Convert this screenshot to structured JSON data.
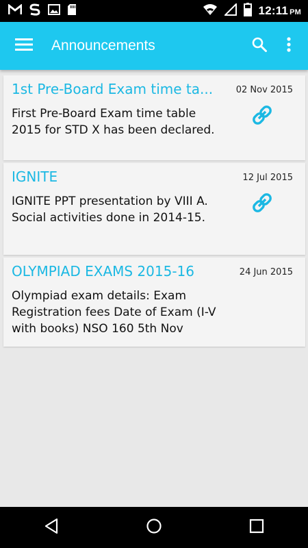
{
  "status_bar": {
    "time": "12:11",
    "ampm": "PM",
    "icons": [
      "gmail-icon",
      "sync-icon",
      "image-icon",
      "sd-card-icon",
      "wifi-icon",
      "signal-icon",
      "battery-icon"
    ]
  },
  "app_bar": {
    "title": "Announcements",
    "color": "#1ec8ef",
    "icons": [
      "menu-icon",
      "search-icon",
      "more-vert-icon"
    ]
  },
  "announcements": [
    {
      "title": "1st Pre-Board Exam time ta...",
      "description": "First Pre-Board Exam time table 2015 for STD X has been declared.",
      "date": "02 Nov 2015",
      "has_link": true
    },
    {
      "title": "IGNITE",
      "description": "IGNITE PPT presentation by VIII A. Social activities done in 2014-15.",
      "date": "12 Jul 2015",
      "has_link": true
    },
    {
      "title": "OLYMPIAD EXAMS 2015-16",
      "description": "Olympiad exam details: Exam Registration fees Date of Exam (I-V with books) NSO 160 5th Nov",
      "date": "24 Jun 2015",
      "has_link": false
    }
  ],
  "nav_bar": {
    "icons": [
      "back-icon",
      "home-icon",
      "recents-icon"
    ]
  }
}
